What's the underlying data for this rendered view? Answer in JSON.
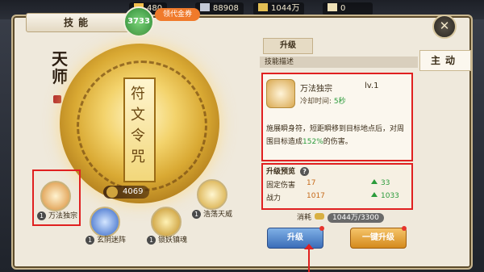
{
  "top_bar": {
    "resources": [
      {
        "value": "480",
        "icon": "resource-icon"
      },
      {
        "value": "88908",
        "icon": "jade-icon"
      },
      {
        "value": "1044万",
        "icon": "gold-icon"
      },
      {
        "value": "0",
        "icon": "scroll-icon"
      }
    ],
    "badge_value": "3733",
    "claim_label": "领代金券"
  },
  "panel": {
    "title": "技能",
    "side_tab": "主动",
    "character_label": "天师",
    "power": "4069",
    "skills": [
      {
        "level": "1",
        "name": "万法独宗"
      },
      {
        "level": "1",
        "name": "玄阴迷阵"
      },
      {
        "level": "1",
        "name": "锁妖镇魂"
      },
      {
        "level": "1",
        "name": "浩荡天威"
      }
    ]
  },
  "right_panel": {
    "tab": "升级",
    "desc_header": "技能描述",
    "skill": {
      "name": "万法独宗",
      "level": "lv.1",
      "cooldown_label": "冷却时间:",
      "cooldown_value": "5秒",
      "description_part1": "施展瞬身符，短距瞬移到目标地点后，对周围目标造成",
      "description_highlight": "152%",
      "description_part2": "的伤害。"
    },
    "preview": {
      "title": "升级预览",
      "rows": [
        {
          "label": "固定伤害",
          "current": "17",
          "next": "33"
        },
        {
          "label": "战力",
          "current": "1017",
          "next": "1033"
        }
      ]
    },
    "consume": {
      "label": "消耗",
      "value": "1044万/3300"
    },
    "buttons": {
      "upgrade": "升级",
      "upgrade_all": "一键升级"
    }
  }
}
